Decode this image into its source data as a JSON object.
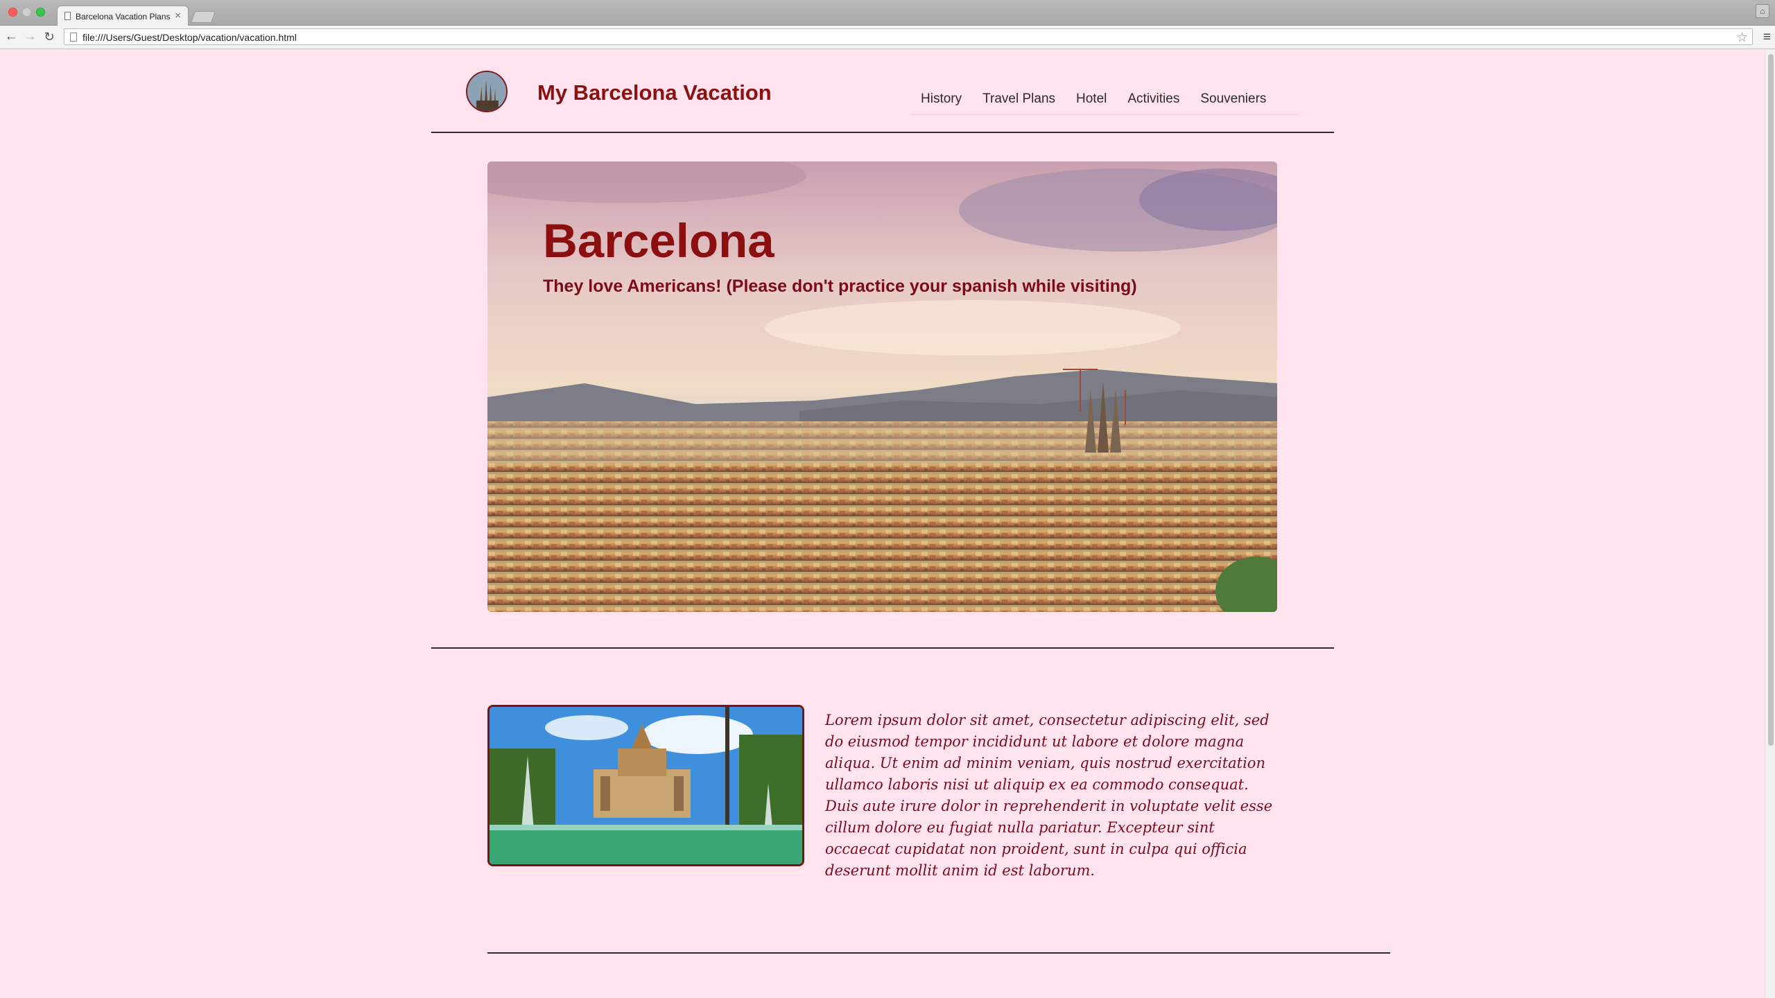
{
  "browser": {
    "tab_title": "Barcelona Vacation Plans",
    "tab_close": "×",
    "url": "file:///Users/Guest/Desktop/vacation/vacation.html"
  },
  "header": {
    "site_title": "My Barcelona Vacation",
    "nav": [
      "History",
      "Travel Plans",
      "Hotel",
      "Activities",
      "Souveniers"
    ]
  },
  "hero": {
    "title": "Barcelona",
    "subtitle": "They love Americans! (Please don't practice your spanish while visiting)"
  },
  "content": {
    "paragraph": "Lorem ipsum dolor sit amet, consectetur adipiscing elit, sed do eiusmod tempor incididunt ut labore et dolore magna aliqua. Ut enim ad minim veniam, quis nostrud exercitation ullamco laboris nisi ut aliquip ex ea commodo consequat. Duis aute irure dolor in reprehenderit in voluptate velit esse cillum dolore eu fugiat nulla pariatur. Excepteur sint occaecat cupidatat non proident, sunt in culpa qui officia deserunt mollit anim id est laborum."
  },
  "colors": {
    "page_background": "#ffe4ef",
    "title_red": "#8b1010",
    "text_maroon": "#7a0a1e"
  },
  "icons": {
    "back": "arrow-left-icon",
    "forward": "arrow-right-icon",
    "reload": "reload-icon",
    "bookmark": "star-icon",
    "menu": "hamburger-menu-icon",
    "profile": "profile-icon"
  }
}
